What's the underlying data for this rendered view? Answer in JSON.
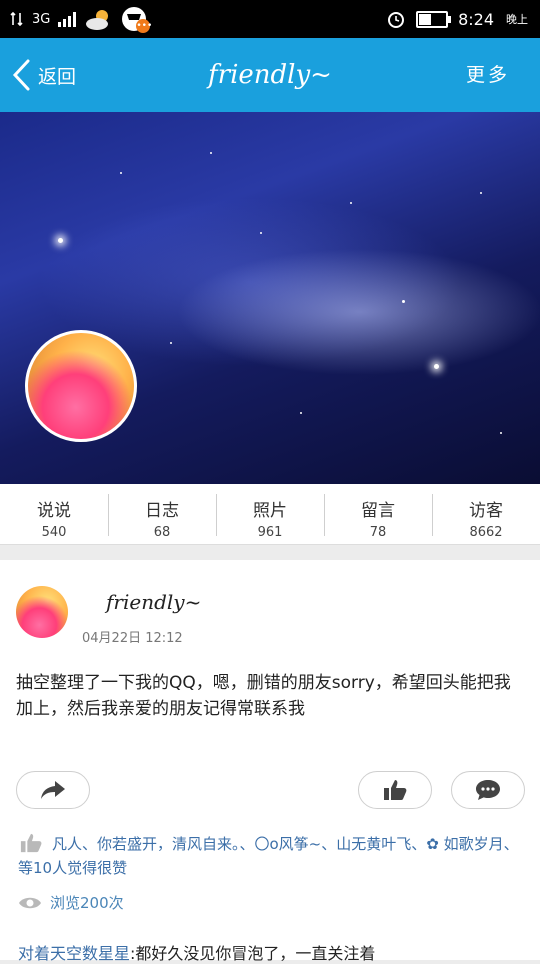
{
  "status_bar": {
    "network": "3G",
    "time": "8:24",
    "ampm": "晚上",
    "notification_count": "•••",
    "battery_level": 0.5
  },
  "nav": {
    "back_label": "返回",
    "title": "friendly~",
    "more_label": "更多"
  },
  "stats": [
    {
      "label": "说说",
      "value": "540"
    },
    {
      "label": "日志",
      "value": "68"
    },
    {
      "label": "照片",
      "value": "961"
    },
    {
      "label": "留言",
      "value": "78"
    },
    {
      "label": "访客",
      "value": "8662"
    }
  ],
  "post": {
    "author": "friendly~",
    "time": "04月22日 12:12",
    "text": "抽空整理了一下我的QQ，嗯，删错的朋友sorry，希望回头能把我加上，然后我亲爱的朋友记得常联系我",
    "likes_text": "凡人、你若盛开，清风自来。、〇o风筝~、山无黄叶飞、✿ 如歌岁月、等10人觉得很赞",
    "views_text": "浏览200次",
    "comment_author": "对着天空数星星",
    "comment_text": ":都好久没见你冒泡了，一直关注着"
  },
  "icons": {
    "back": "chevron-left-icon",
    "share": "share-arrow-icon",
    "like": "thumbs-up-icon",
    "comment": "comment-bubble-icon",
    "views": "eye-icon",
    "weather": "weather-icon"
  },
  "colors": {
    "nav": "#1aa0dd",
    "link": "#3c6fa8",
    "badge": "#f07a1a"
  }
}
